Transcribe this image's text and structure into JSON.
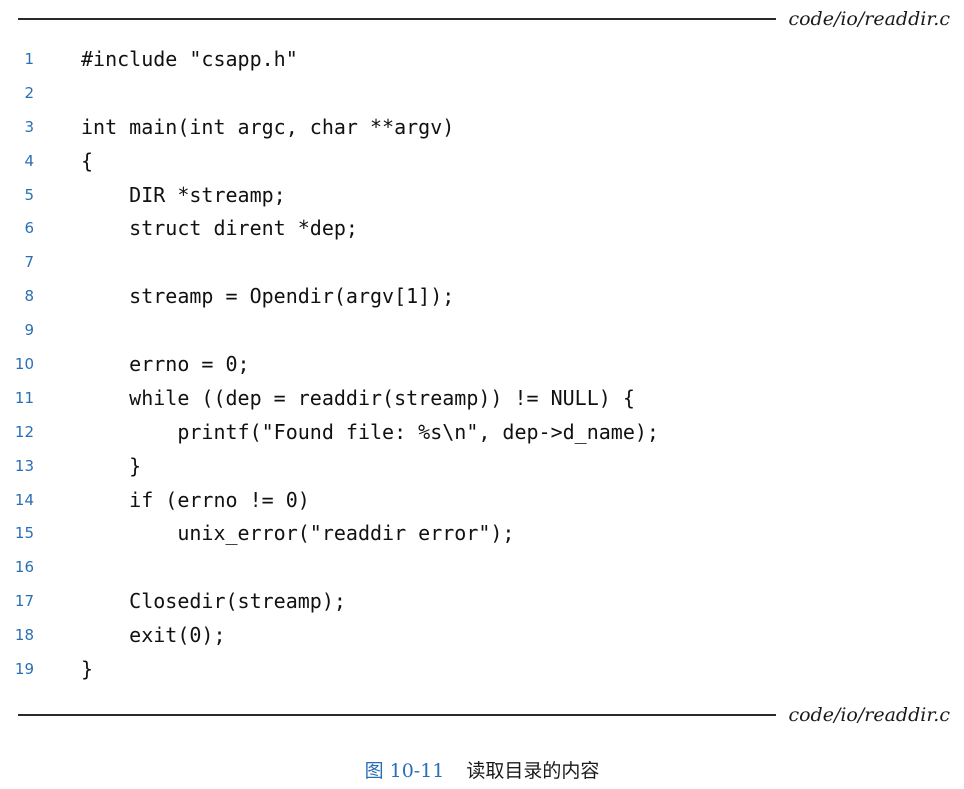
{
  "file_label": "code/io/readdir.c",
  "code_lines": [
    {
      "no": "1",
      "text": "#include \"csapp.h\""
    },
    {
      "no": "2",
      "text": ""
    },
    {
      "no": "3",
      "text": "int main(int argc, char **argv)"
    },
    {
      "no": "4",
      "text": "{"
    },
    {
      "no": "5",
      "text": "    DIR *streamp;"
    },
    {
      "no": "6",
      "text": "    struct dirent *dep;"
    },
    {
      "no": "7",
      "text": ""
    },
    {
      "no": "8",
      "text": "    streamp = Opendir(argv[1]);"
    },
    {
      "no": "9",
      "text": ""
    },
    {
      "no": "10",
      "text": "    errno = 0;"
    },
    {
      "no": "11",
      "text": "    while ((dep = readdir(streamp)) != NULL) {"
    },
    {
      "no": "12",
      "text": "        printf(\"Found file: %s\\n\", dep->d_name);"
    },
    {
      "no": "13",
      "text": "    }"
    },
    {
      "no": "14",
      "text": "    if (errno != 0)"
    },
    {
      "no": "15",
      "text": "        unix_error(\"readdir error\");"
    },
    {
      "no": "16",
      "text": ""
    },
    {
      "no": "17",
      "text": "    Closedir(streamp);"
    },
    {
      "no": "18",
      "text": "    exit(0);"
    },
    {
      "no": "19",
      "text": "}"
    }
  ],
  "caption": {
    "number": "图 10-11",
    "text": "读取目录的内容"
  },
  "colors": {
    "line_number": "#2a6fb5",
    "rule": "#2a2a2a"
  }
}
